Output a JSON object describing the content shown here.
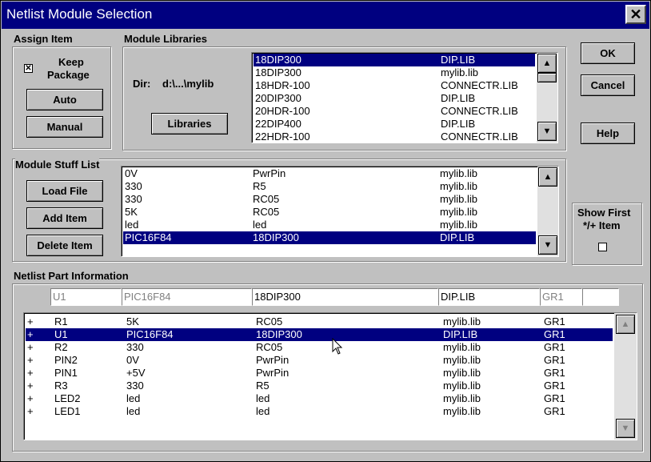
{
  "window": {
    "title": "Netlist Module Selection",
    "close_label": "✕"
  },
  "assign": {
    "label": "Assign Item",
    "keep_line1": "Keep",
    "keep_line2": "Package",
    "keep_check": "✕",
    "auto": "Auto",
    "manual": "Manual"
  },
  "modlib": {
    "label": "Module Libraries",
    "dir_label": "Dir:",
    "dir_value": "d:\\...\\mylib",
    "libraries_button": "Libraries",
    "rows": [
      [
        "18DIP300",
        "DIP.LIB"
      ],
      [
        "18DIP300",
        "mylib.lib"
      ],
      [
        "18HDR-100",
        "CONNECTR.LIB"
      ],
      [
        "20DIP300",
        "DIP.LIB"
      ],
      [
        "20HDR-100",
        "CONNECTR.LIB"
      ],
      [
        "22DIP400",
        "DIP.LIB"
      ],
      [
        "22HDR-100",
        "CONNECTR.LIB"
      ]
    ]
  },
  "buttons": {
    "ok": "OK",
    "cancel": "Cancel",
    "help": "Help"
  },
  "stuff": {
    "label": "Module Stuff List",
    "load": "Load File",
    "add": "Add Item",
    "delete": "Delete Item",
    "rows": [
      [
        "0V",
        "PwrPin",
        "mylib.lib"
      ],
      [
        "330",
        "R5",
        "mylib.lib"
      ],
      [
        "330",
        "RC05",
        "mylib.lib"
      ],
      [
        "5K",
        "RC05",
        "mylib.lib"
      ],
      [
        "led",
        "led",
        "mylib.lib"
      ],
      [
        "PIC16F84",
        "18DIP300",
        "DIP.LIB"
      ]
    ]
  },
  "showfirst": {
    "line1": "Show First",
    "line2": "*/+ Item"
  },
  "netlist": {
    "label": "Netlist Part Information",
    "fields": [
      "U1",
      "PIC16F84",
      "18DIP300",
      "DIP.LIB",
      "GR1",
      ""
    ],
    "rows": [
      [
        "+",
        "R1",
        "5K",
        "RC05",
        "mylib.lib",
        "GR1"
      ],
      [
        "+",
        "U1",
        "PIC16F84",
        "18DIP300",
        "DIP.LIB",
        "GR1"
      ],
      [
        "+",
        "R2",
        "330",
        "RC05",
        "mylib.lib",
        "GR1"
      ],
      [
        "+",
        "PIN2",
        "0V",
        "PwrPin",
        "mylib.lib",
        "GR1"
      ],
      [
        "+",
        "PIN1",
        "+5V",
        "PwrPin",
        "mylib.lib",
        "GR1"
      ],
      [
        "+",
        "R3",
        "330",
        "R5",
        "mylib.lib",
        "GR1"
      ],
      [
        "+",
        "LED2",
        "led",
        "led",
        "mylib.lib",
        "GR1"
      ],
      [
        "+",
        "LED1",
        "led",
        "led",
        "mylib.lib",
        "GR1"
      ]
    ]
  },
  "scroll": {
    "up": "▲",
    "down": "▼"
  }
}
